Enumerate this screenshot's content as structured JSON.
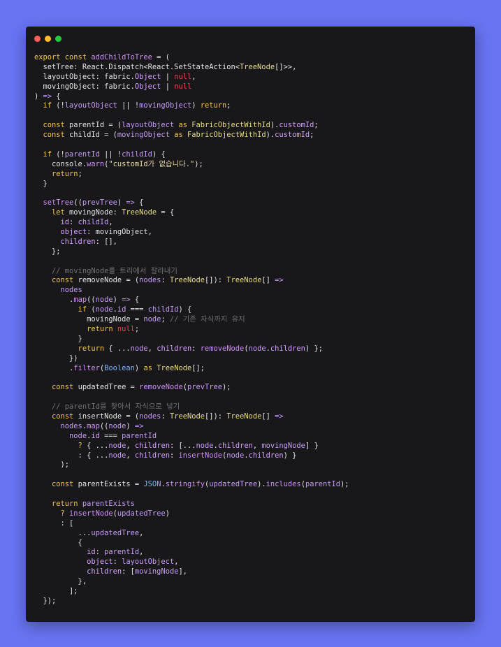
{
  "window": {
    "buttons": {
      "close": "close",
      "minimize": "minimize",
      "maximize": "maximize"
    }
  },
  "code_lines": [
    [
      [
        "keyword",
        "export const "
      ],
      [
        "function",
        "addChildToTree"
      ],
      [
        "punct",
        " = ("
      ]
    ],
    [
      [
        "plain",
        "  setTree: React.Dispatch<React.SetStateAction<"
      ],
      [
        "type",
        "TreeNode"
      ],
      [
        "plain",
        "[]>>,"
      ]
    ],
    [
      [
        "plain",
        "  layoutObject: fabric."
      ],
      [
        "property",
        "Object"
      ],
      [
        "punct",
        " | "
      ],
      [
        "null",
        "null"
      ],
      [
        "punct",
        ","
      ]
    ],
    [
      [
        "plain",
        "  movingObject: fabric."
      ],
      [
        "property",
        "Object"
      ],
      [
        "punct",
        " | "
      ],
      [
        "null",
        "null"
      ]
    ],
    [
      [
        "punct",
        ") "
      ],
      [
        "arrow",
        "=>"
      ],
      [
        "punct",
        " {"
      ]
    ],
    [
      [
        "keyword",
        "  if "
      ],
      [
        "punct",
        "(!"
      ],
      [
        "param",
        "layoutObject"
      ],
      [
        "punct",
        " || !"
      ],
      [
        "param",
        "movingObject"
      ],
      [
        "punct",
        ") "
      ],
      [
        "keyword",
        "return"
      ],
      [
        "punct",
        ";"
      ]
    ],
    [
      [
        "plain",
        ""
      ]
    ],
    [
      [
        "keyword",
        "  const "
      ],
      [
        "identifier",
        "parentId"
      ],
      [
        "punct",
        " = ("
      ],
      [
        "param",
        "layoutObject"
      ],
      [
        "keyword",
        " as "
      ],
      [
        "type",
        "FabricObjectWithId"
      ],
      [
        "punct",
        ")."
      ],
      [
        "property",
        "customId"
      ],
      [
        "punct",
        ";"
      ]
    ],
    [
      [
        "keyword",
        "  const "
      ],
      [
        "identifier",
        "childId"
      ],
      [
        "punct",
        " = ("
      ],
      [
        "param",
        "movingObject"
      ],
      [
        "keyword",
        " as "
      ],
      [
        "type",
        "FabricObjectWithId"
      ],
      [
        "punct",
        ")."
      ],
      [
        "property",
        "customId"
      ],
      [
        "punct",
        ";"
      ]
    ],
    [
      [
        "plain",
        ""
      ]
    ],
    [
      [
        "keyword",
        "  if "
      ],
      [
        "punct",
        "(!"
      ],
      [
        "param",
        "parentId"
      ],
      [
        "punct",
        " || !"
      ],
      [
        "param",
        "childId"
      ],
      [
        "punct",
        ") {"
      ]
    ],
    [
      [
        "plain",
        "    console."
      ],
      [
        "function",
        "warn"
      ],
      [
        "punct",
        "("
      ],
      [
        "string",
        "\"customId가 없습니다.\""
      ],
      [
        "punct",
        ");"
      ]
    ],
    [
      [
        "keyword",
        "    return"
      ],
      [
        "punct",
        ";"
      ]
    ],
    [
      [
        "punct",
        "  }"
      ]
    ],
    [
      [
        "plain",
        ""
      ]
    ],
    [
      [
        "function",
        "  setTree"
      ],
      [
        "punct",
        "(("
      ],
      [
        "param",
        "prevTree"
      ],
      [
        "punct",
        ") "
      ],
      [
        "arrow",
        "=>"
      ],
      [
        "punct",
        " {"
      ]
    ],
    [
      [
        "keyword",
        "    let "
      ],
      [
        "identifier",
        "movingNode"
      ],
      [
        "punct",
        ": "
      ],
      [
        "type",
        "TreeNode"
      ],
      [
        "punct",
        " = {"
      ]
    ],
    [
      [
        "property",
        "      id"
      ],
      [
        "punct",
        ": "
      ],
      [
        "param",
        "childId"
      ],
      [
        "punct",
        ","
      ]
    ],
    [
      [
        "property",
        "      object"
      ],
      [
        "punct",
        ": "
      ],
      [
        "identifier",
        "movingObject"
      ],
      [
        "punct",
        ","
      ]
    ],
    [
      [
        "property",
        "      children"
      ],
      [
        "punct",
        ": [],"
      ]
    ],
    [
      [
        "punct",
        "    };"
      ]
    ],
    [
      [
        "plain",
        ""
      ]
    ],
    [
      [
        "comment",
        "    // movingNode를 트리에서 잘라내기"
      ]
    ],
    [
      [
        "keyword",
        "    const "
      ],
      [
        "identifier",
        "removeNode"
      ],
      [
        "punct",
        " = ("
      ],
      [
        "param",
        "nodes"
      ],
      [
        "punct",
        ": "
      ],
      [
        "type",
        "TreeNode"
      ],
      [
        "punct",
        "[]): "
      ],
      [
        "type",
        "TreeNode"
      ],
      [
        "punct",
        "[] "
      ],
      [
        "arrow",
        "=>"
      ]
    ],
    [
      [
        "param",
        "      nodes"
      ]
    ],
    [
      [
        "punct",
        "        ."
      ],
      [
        "function",
        "map"
      ],
      [
        "punct",
        "(("
      ],
      [
        "param",
        "node"
      ],
      [
        "punct",
        ") "
      ],
      [
        "arrow",
        "=>"
      ],
      [
        "punct",
        " {"
      ]
    ],
    [
      [
        "keyword",
        "          if "
      ],
      [
        "punct",
        "("
      ],
      [
        "param",
        "node"
      ],
      [
        "punct",
        "."
      ],
      [
        "property",
        "id"
      ],
      [
        "punct",
        " === "
      ],
      [
        "param",
        "childId"
      ],
      [
        "punct",
        ") {"
      ]
    ],
    [
      [
        "identifier",
        "            movingNode"
      ],
      [
        "punct",
        " = "
      ],
      [
        "param",
        "node"
      ],
      [
        "punct",
        "; "
      ],
      [
        "comment",
        "// 기존 자식까지 유지"
      ]
    ],
    [
      [
        "keyword",
        "            return "
      ],
      [
        "null",
        "null"
      ],
      [
        "punct",
        ";"
      ]
    ],
    [
      [
        "punct",
        "          }"
      ]
    ],
    [
      [
        "keyword",
        "          return "
      ],
      [
        "punct",
        "{ ..."
      ],
      [
        "param",
        "node"
      ],
      [
        "punct",
        ", "
      ],
      [
        "property",
        "children"
      ],
      [
        "punct",
        ": "
      ],
      [
        "function",
        "removeNode"
      ],
      [
        "punct",
        "("
      ],
      [
        "param",
        "node"
      ],
      [
        "punct",
        "."
      ],
      [
        "property",
        "children"
      ],
      [
        "punct",
        ") };"
      ]
    ],
    [
      [
        "punct",
        "        })"
      ]
    ],
    [
      [
        "punct",
        "        ."
      ],
      [
        "function",
        "filter"
      ],
      [
        "punct",
        "("
      ],
      [
        "builtin",
        "Boolean"
      ],
      [
        "punct",
        ")"
      ],
      [
        "keyword",
        " as "
      ],
      [
        "type",
        "TreeNode"
      ],
      [
        "punct",
        "[];"
      ]
    ],
    [
      [
        "plain",
        ""
      ]
    ],
    [
      [
        "keyword",
        "    const "
      ],
      [
        "identifier",
        "updatedTree"
      ],
      [
        "punct",
        " = "
      ],
      [
        "function",
        "removeNode"
      ],
      [
        "punct",
        "("
      ],
      [
        "param",
        "prevTree"
      ],
      [
        "punct",
        ");"
      ]
    ],
    [
      [
        "plain",
        ""
      ]
    ],
    [
      [
        "comment",
        "    // parentId를 찾아서 자식으로 넣기"
      ]
    ],
    [
      [
        "keyword",
        "    const "
      ],
      [
        "identifier",
        "insertNode"
      ],
      [
        "punct",
        " = ("
      ],
      [
        "param",
        "nodes"
      ],
      [
        "punct",
        ": "
      ],
      [
        "type",
        "TreeNode"
      ],
      [
        "punct",
        "[]): "
      ],
      [
        "type",
        "TreeNode"
      ],
      [
        "punct",
        "[] "
      ],
      [
        "arrow",
        "=>"
      ]
    ],
    [
      [
        "param",
        "      nodes"
      ],
      [
        "punct",
        "."
      ],
      [
        "function",
        "map"
      ],
      [
        "punct",
        "(("
      ],
      [
        "param",
        "node"
      ],
      [
        "punct",
        ") "
      ],
      [
        "arrow",
        "=>"
      ]
    ],
    [
      [
        "param",
        "        node"
      ],
      [
        "punct",
        "."
      ],
      [
        "property",
        "id"
      ],
      [
        "punct",
        " === "
      ],
      [
        "param",
        "parentId"
      ]
    ],
    [
      [
        "op",
        "          ?"
      ],
      [
        "punct",
        " { ..."
      ],
      [
        "param",
        "node"
      ],
      [
        "punct",
        ", "
      ],
      [
        "property",
        "children"
      ],
      [
        "punct",
        ": [..."
      ],
      [
        "param",
        "node"
      ],
      [
        "punct",
        "."
      ],
      [
        "property",
        "children"
      ],
      [
        "punct",
        ", "
      ],
      [
        "param",
        "movingNode"
      ],
      [
        "punct",
        "] }"
      ]
    ],
    [
      [
        "punct",
        "          : { ..."
      ],
      [
        "param",
        "node"
      ],
      [
        "punct",
        ", "
      ],
      [
        "property",
        "children"
      ],
      [
        "punct",
        ": "
      ],
      [
        "function",
        "insertNode"
      ],
      [
        "punct",
        "("
      ],
      [
        "param",
        "node"
      ],
      [
        "punct",
        "."
      ],
      [
        "property",
        "children"
      ],
      [
        "punct",
        ") }"
      ]
    ],
    [
      [
        "punct",
        "      );"
      ]
    ],
    [
      [
        "plain",
        ""
      ]
    ],
    [
      [
        "keyword",
        "    const "
      ],
      [
        "identifier",
        "parentExists"
      ],
      [
        "punct",
        " = "
      ],
      [
        "builtin",
        "JSON"
      ],
      [
        "punct",
        "."
      ],
      [
        "function",
        "stringify"
      ],
      [
        "punct",
        "("
      ],
      [
        "param",
        "updatedTree"
      ],
      [
        "punct",
        ")."
      ],
      [
        "function",
        "includes"
      ],
      [
        "punct",
        "("
      ],
      [
        "param",
        "parentId"
      ],
      [
        "punct",
        ");"
      ]
    ],
    [
      [
        "plain",
        ""
      ]
    ],
    [
      [
        "keyword",
        "    return "
      ],
      [
        "param",
        "parentExists"
      ]
    ],
    [
      [
        "op",
        "      ?"
      ],
      [
        "function",
        " insertNode"
      ],
      [
        "punct",
        "("
      ],
      [
        "param",
        "updatedTree"
      ],
      [
        "punct",
        ")"
      ]
    ],
    [
      [
        "punct",
        "      : ["
      ]
    ],
    [
      [
        "punct",
        "          ..."
      ],
      [
        "param",
        "updatedTree"
      ],
      [
        "punct",
        ","
      ]
    ],
    [
      [
        "punct",
        "          {"
      ]
    ],
    [
      [
        "property",
        "            id"
      ],
      [
        "punct",
        ": "
      ],
      [
        "param",
        "parentId"
      ],
      [
        "punct",
        ","
      ]
    ],
    [
      [
        "property",
        "            object"
      ],
      [
        "punct",
        ": "
      ],
      [
        "param",
        "layoutObject"
      ],
      [
        "punct",
        ","
      ]
    ],
    [
      [
        "property",
        "            children"
      ],
      [
        "punct",
        ": ["
      ],
      [
        "param",
        "movingNode"
      ],
      [
        "punct",
        "],"
      ]
    ],
    [
      [
        "punct",
        "          },"
      ]
    ],
    [
      [
        "punct",
        "        ];"
      ]
    ],
    [
      [
        "punct",
        "  });"
      ]
    ]
  ]
}
